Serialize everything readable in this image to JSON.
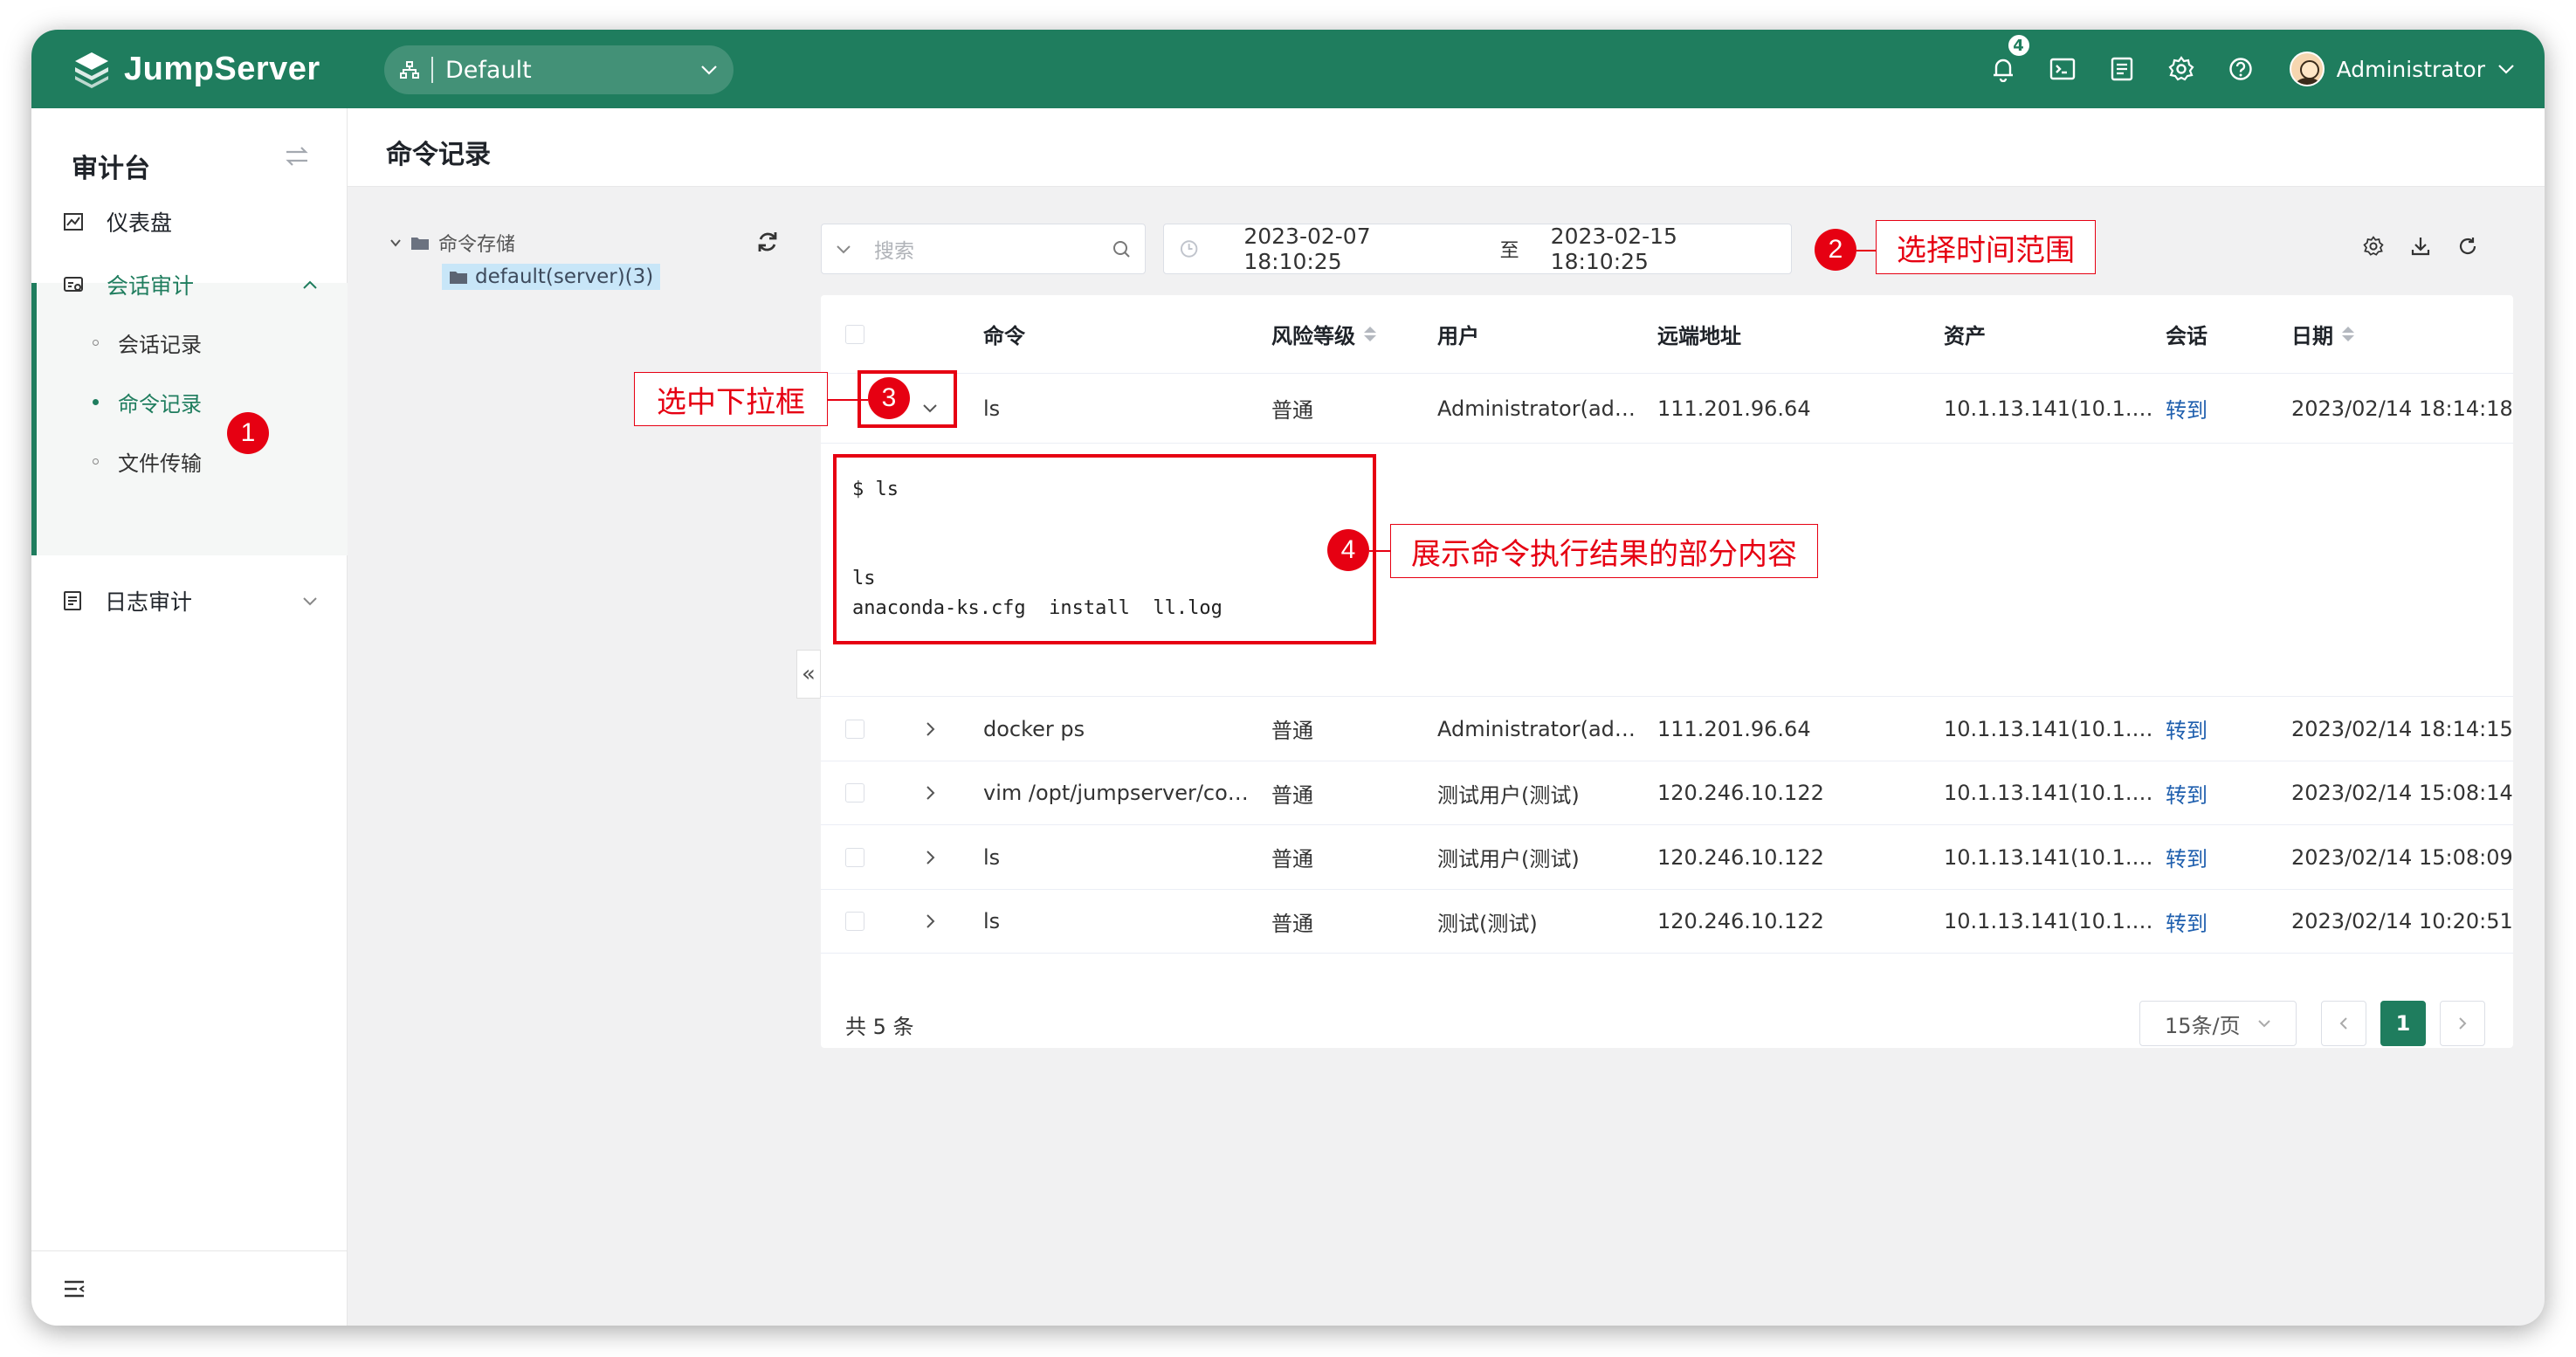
{
  "app": {
    "logo_text": "JumpServer",
    "org": "Default",
    "notification_count": "4",
    "user": "Administrator"
  },
  "sidebar": {
    "title": "审计台",
    "items": [
      {
        "label": "仪表盘"
      },
      {
        "label": "会话审计"
      },
      {
        "label": "日志审计"
      }
    ],
    "sub_items": [
      {
        "label": "会话记录"
      },
      {
        "label": "命令记录"
      },
      {
        "label": "文件传输"
      }
    ]
  },
  "page": {
    "title": "命令记录"
  },
  "tree": {
    "root": "命令存储",
    "leaf": "default(server)(3)"
  },
  "toolbar": {
    "search_placeholder": "搜索",
    "date_from": "2023-02-07 18:10:25",
    "date_sep": "至",
    "date_to": "2023-02-15 18:10:25"
  },
  "table": {
    "columns": [
      "命令",
      "风险等级",
      "用户",
      "远端地址",
      "资产",
      "会话",
      "日期"
    ],
    "rows": [
      {
        "command": "ls",
        "risk": "普通",
        "user": "Administrator(ad…",
        "remote": "111.201.96.64",
        "asset": "10.1.13.141(10.1.…",
        "session": "转到",
        "date": "2023/02/14 18:14:18"
      },
      {
        "command": "docker ps",
        "risk": "普通",
        "user": "Administrator(ad…",
        "remote": "111.201.96.64",
        "asset": "10.1.13.141(10.1.…",
        "session": "转到",
        "date": "2023/02/14 18:14:15"
      },
      {
        "command": "vim /opt/jumpserver/co…",
        "risk": "普通",
        "user": "测试用户(测试)",
        "remote": "120.246.10.122",
        "asset": "10.1.13.141(10.1.…",
        "session": "转到",
        "date": "2023/02/14 15:08:14"
      },
      {
        "command": "ls",
        "risk": "普通",
        "user": "测试用户(测试)",
        "remote": "120.246.10.122",
        "asset": "10.1.13.141(10.1.…",
        "session": "转到",
        "date": "2023/02/14 15:08:09"
      },
      {
        "command": "ls",
        "risk": "普通",
        "user": "测试(测试)",
        "remote": "120.246.10.122",
        "asset": "10.1.13.141(10.1.…",
        "session": "转到",
        "date": "2023/02/14 10:20:51"
      }
    ],
    "expanded_output": "$ ls\n\n\nls\nanaconda-ks.cfg  install  ll.log"
  },
  "pagination": {
    "total": "共 5 条",
    "page_size": "15条/页",
    "current_page": "1"
  },
  "annotations": [
    {
      "num": "1"
    },
    {
      "num": "2",
      "label": "选择时间范围"
    },
    {
      "num": "3",
      "label": "选中下拉框"
    },
    {
      "num": "4",
      "label": "展示命令执行结果的部分内容"
    }
  ],
  "colors": {
    "brand": "#1f7d5e",
    "link": "#1f5fae",
    "annotation": "#e60012"
  }
}
